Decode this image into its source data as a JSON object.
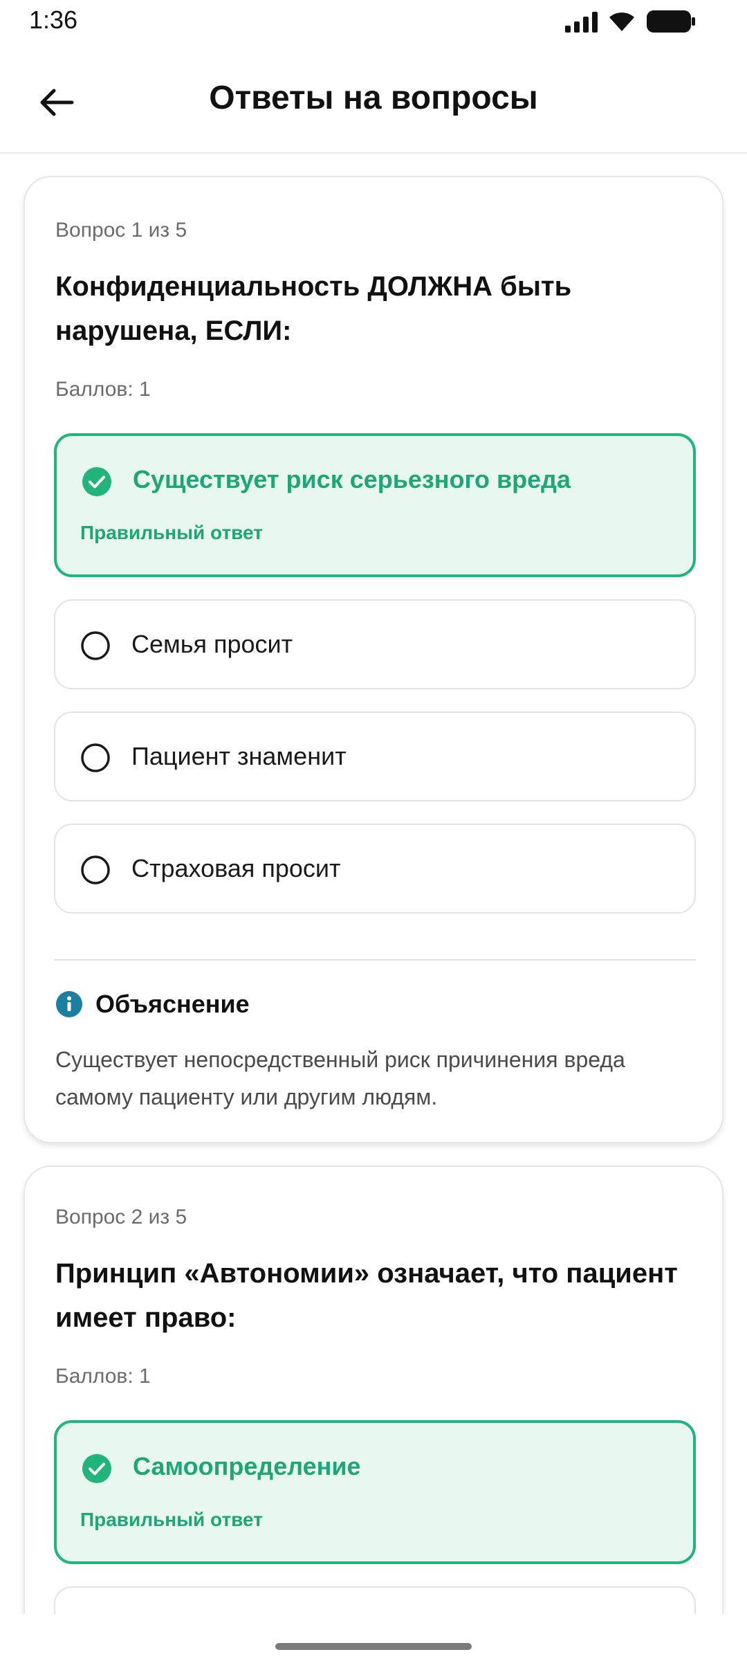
{
  "status": {
    "time": "1:36"
  },
  "header": {
    "title": "Ответы на вопросы"
  },
  "questions": [
    {
      "counter": "Вопрос 1 из 5",
      "text": "Конфиденциальность ДОЛЖНА быть нарушена, ЕСЛИ:",
      "points": "Баллов: 1",
      "correct_option": "Существует риск серьезного вреда",
      "correct_label": "Правильный ответ",
      "options": [
        "Семья просит",
        "Пациент знаменит",
        "Страховая просит"
      ],
      "explanation_title": "Объяснение",
      "explanation": "Существует непосредственный риск причинения вреда самому пациенту или другим людям."
    },
    {
      "counter": "Вопрос 2 из 5",
      "text": "Принцип «Автономии» означает, что пациент имеет право:",
      "points": "Баллов: 1",
      "correct_option": "Самоопределение",
      "correct_label": "Правильный ответ"
    }
  ],
  "colors": {
    "correct": "#21b57c",
    "correct_bg": "#e9f7f1",
    "info": "#1b7fa3"
  }
}
